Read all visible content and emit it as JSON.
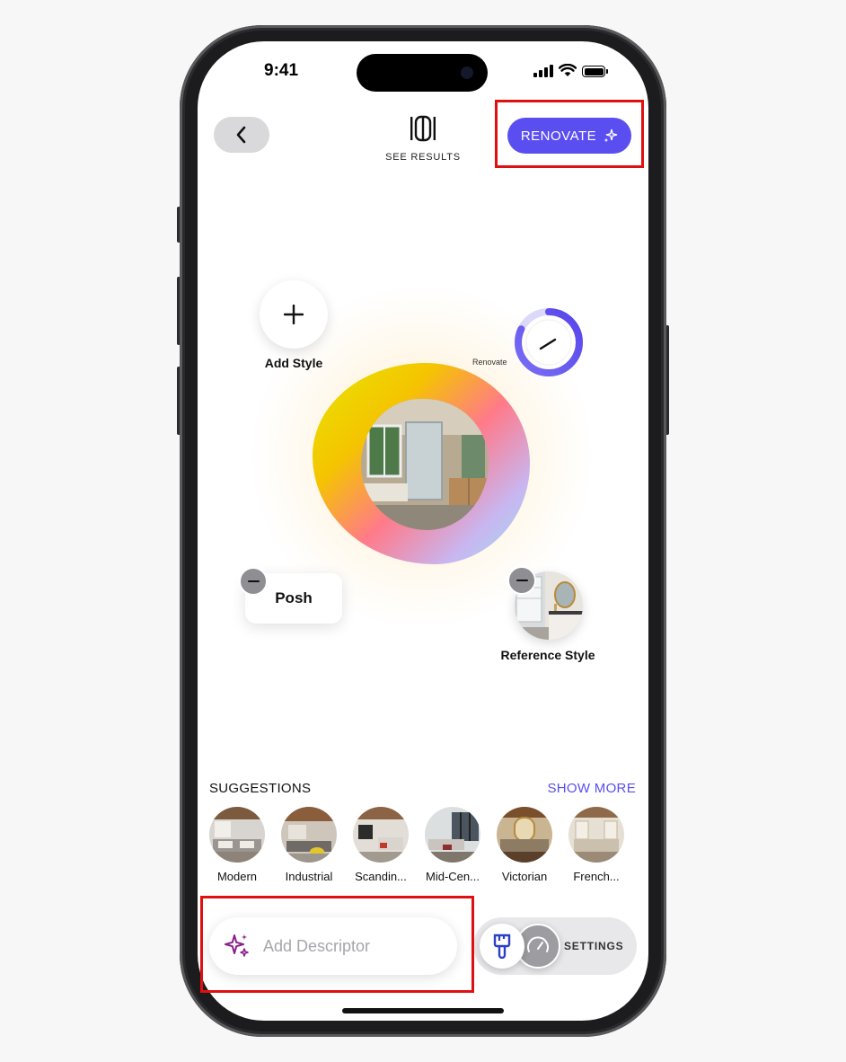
{
  "status_bar": {
    "time": "9:41"
  },
  "header": {
    "see_results_label": "SEE RESULTS",
    "renovate_label": "RENOVATE"
  },
  "canvas": {
    "add_style_label": "Add Style",
    "renovate_dial_label": "Renovate",
    "renovate_level_fraction": 0.82,
    "style_chips": [
      {
        "label": "Posh"
      },
      {
        "label": "Reference Style"
      }
    ]
  },
  "suggestions": {
    "title": "SUGGESTIONS",
    "show_more": "SHOW MORE",
    "items": [
      {
        "label": "Modern"
      },
      {
        "label": "Industrial"
      },
      {
        "label": "Scandin..."
      },
      {
        "label": "Mid-Cen..."
      },
      {
        "label": "Victorian"
      },
      {
        "label": "French..."
      }
    ]
  },
  "bottom_bar": {
    "descriptor_placeholder": "Add Descriptor",
    "settings_label": "SETTINGS"
  },
  "colors": {
    "accent": "#5a4ef0",
    "highlight": "#e01010",
    "sparkle": "#8a1f8a",
    "paint": "#2a3ec8"
  },
  "icons": {
    "back": "chevron-left-icon",
    "see_results": "compare-columns-icon",
    "renovate": "sparkle-icon",
    "add_style": "plus-icon",
    "remove": "minus-icon",
    "descriptor": "sparkles-icon",
    "paint": "paintbrush-icon",
    "settings": "gauge-icon"
  }
}
